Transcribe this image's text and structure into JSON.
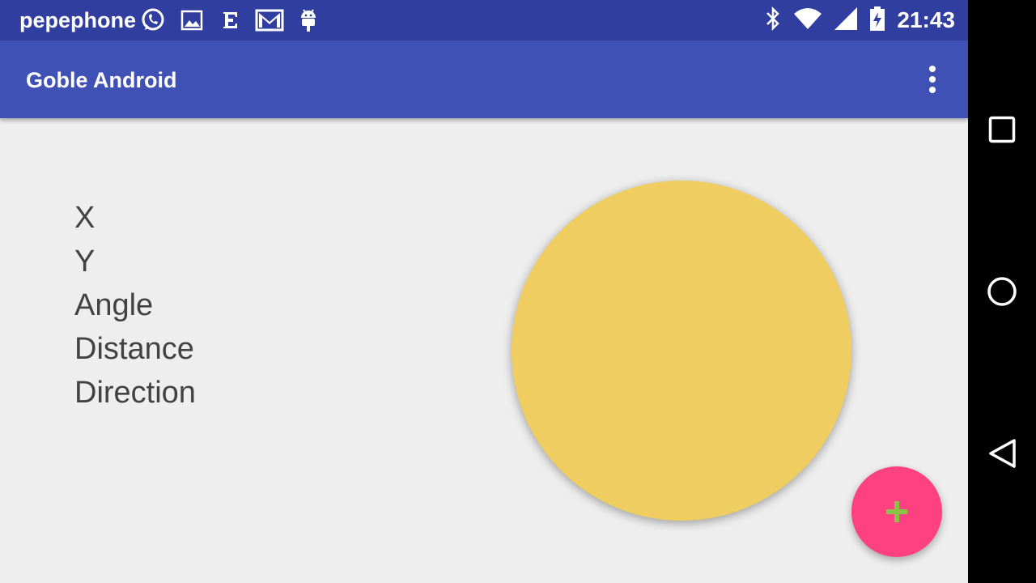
{
  "status_bar": {
    "carrier": "pepephone",
    "time": "21:43",
    "notification_icons": [
      "whatsapp-icon",
      "image-icon",
      "e-icon",
      "gmail-icon",
      "android-icon"
    ],
    "system_icons": [
      "bluetooth-icon",
      "wifi-icon",
      "cell-signal-icon",
      "battery-charging-icon"
    ]
  },
  "app_bar": {
    "title": "Goble Android",
    "overflow_icon": "more-vert-icon"
  },
  "info": {
    "items": [
      "X",
      "Y",
      "Angle",
      "Distance",
      "Direction"
    ]
  },
  "colors": {
    "status_bar": "#303f9f",
    "app_bar": "#3f51b5",
    "background": "#eeeeee",
    "joystick": "#f0cd60",
    "fab": "#ff4081",
    "fab_icon": "#8bc34a",
    "text": "#424242"
  },
  "fab": {
    "icon": "plus-icon"
  },
  "nav_bar": {
    "buttons": [
      "recents-icon",
      "home-icon",
      "back-icon"
    ]
  }
}
